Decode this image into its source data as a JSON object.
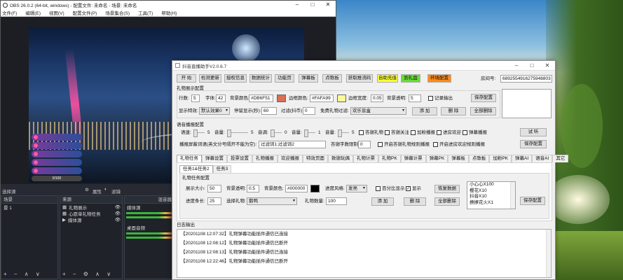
{
  "obs": {
    "title": "OBS 26.0.2 (64-bit, windows) - 配置文件: 未命名 - 场景: 未命名",
    "menu": [
      "文件(F)",
      "编辑(E)",
      "视图(V)",
      "配置文件(P)",
      "场景集合(S)",
      "工具(T)",
      "帮助(H)"
    ],
    "controls_left": "选择源",
    "filters_label": "属性",
    "filters_label2": "滤镜",
    "scenes_header": "场景",
    "scene_item": "景 1",
    "sources_header": "来源",
    "sources": [
      "礼物展示",
      "心愿单礼物任务",
      "媒体源"
    ],
    "mixer_header": "混音器",
    "mixer_items": [
      "媒体源",
      "桌面音频"
    ],
    "gift_bar_text": "0/100"
  },
  "plugin": {
    "title": "抖音直播助手V2.0.6.7",
    "toolbar": [
      "开 始",
      "检测更新",
      "授权信息",
      "数据统计",
      "功能页",
      "弹幕板",
      "点歌板",
      "获取推流码",
      "自助充值",
      "到礼盘",
      "环境配置"
    ],
    "toolbar_colors": {
      "自助充值": "#ffff33",
      "到礼盘": "#66dd33",
      "环境配置": "#ff8a1a"
    },
    "room_label": "房间号:",
    "room_value": "6892554916275948803",
    "gift_display": {
      "section": "礼物展示配置",
      "rows_label": "行数:",
      "rows_value": "5",
      "font_label": "字体:",
      "font_value": "42",
      "bg_color_label": "背景颜色:",
      "bg_color_value": "#DB6F51",
      "border_color_label": "边框颜色:",
      "border_color_value": "#FAFA99",
      "border_width_label": "边框宽度:",
      "border_width_value": "0.05",
      "bg_opacity_label": "背景透明:",
      "bg_opacity_value": "5",
      "record_output": "记录输出",
      "save": "保存配置",
      "effect_label": "显示特效:",
      "effect_value": "默认效果0",
      "stay_label": "停留显示(秒):",
      "stay_value": "60",
      "filter_label": "过滤(抖币):",
      "filter_value": "0",
      "gift_filter_label": "免费礼物过滤:",
      "gift_filter_value": "欢乐盲盒",
      "add": "添 加",
      "delete": "删 除",
      "delete_all": "全部删除"
    },
    "voice": {
      "section": "语音播报配置",
      "speed_label": "语速:",
      "speed_value": "5",
      "volume_label": "音量:",
      "volume_value": "5",
      "pitch_label": "音调:",
      "pitch_value": "0",
      "voice_label": "音量:",
      "voice_value": "1",
      "fans_label": "音量:",
      "fans_value": "5",
      "checks": [
        "答谢礼物",
        "答谢关注",
        "加粉播报",
        "进房欢迎",
        "弹幕播报"
      ],
      "test": "试 听",
      "template_label": "播报屏蔽词语(英文分号隔开不能为空):",
      "template_value": "过滤词1;过滤词2",
      "thanks_label": "答谢字数限制:",
      "thanks_value": "0",
      "checks2": [
        "开启答谢礼物规则播报",
        "开启进房欢迎规则播报"
      ],
      "save": "保存配置"
    },
    "tabs": [
      "礼物任务",
      "弹幕设置",
      "投票设置",
      "礼物播报",
      "欢迎播报",
      "特效页面",
      "致谢玩偶",
      "礼物计票",
      "礼物PK",
      "弹幕计票",
      "弹幕PK",
      "弹幕板",
      "点歌板",
      "加粉PK",
      "弹幕AI",
      "语音AI",
      "其它"
    ],
    "subtabs": [
      "任务1&任务2",
      "任务3"
    ],
    "task": {
      "section": "礼物任务配置",
      "size_label": "展示大小:",
      "size_value": "50",
      "opacity_label": "背景透明:",
      "opacity_value": "0.5",
      "bg_color_label": "背景颜色:",
      "bg_color_value": "#000000",
      "style_label": "进度风格:",
      "style_value": "发亮",
      "percent": "百分比显示",
      "show": "显示",
      "restore": "恢复数据",
      "length_label": "进度条长:",
      "length_value": "25",
      "gift_label": "选择礼物:",
      "gift_value": "鹅鸭",
      "count_label": "礼物数量:",
      "count_value": "100",
      "add": "添 加",
      "delete": "删 除",
      "delete_all": "全部删除",
      "list": [
        "小心心X100",
        "樱花X10",
        "抖音X10",
        "撩撩花火X1"
      ],
      "save": "保存配置"
    },
    "log": {
      "section": "日志输出",
      "lines": [
        "【20201108 12:07:32】礼物弹幕功能插件通信已连接",
        "【20201108 12:08:12】礼物弹幕功能插件通信已断开",
        "【20201108 12:08:13】礼物弹幕功能插件通信已连接",
        "【20201108 12:22:46】礼物弹幕功能插件通信已断开"
      ]
    }
  }
}
